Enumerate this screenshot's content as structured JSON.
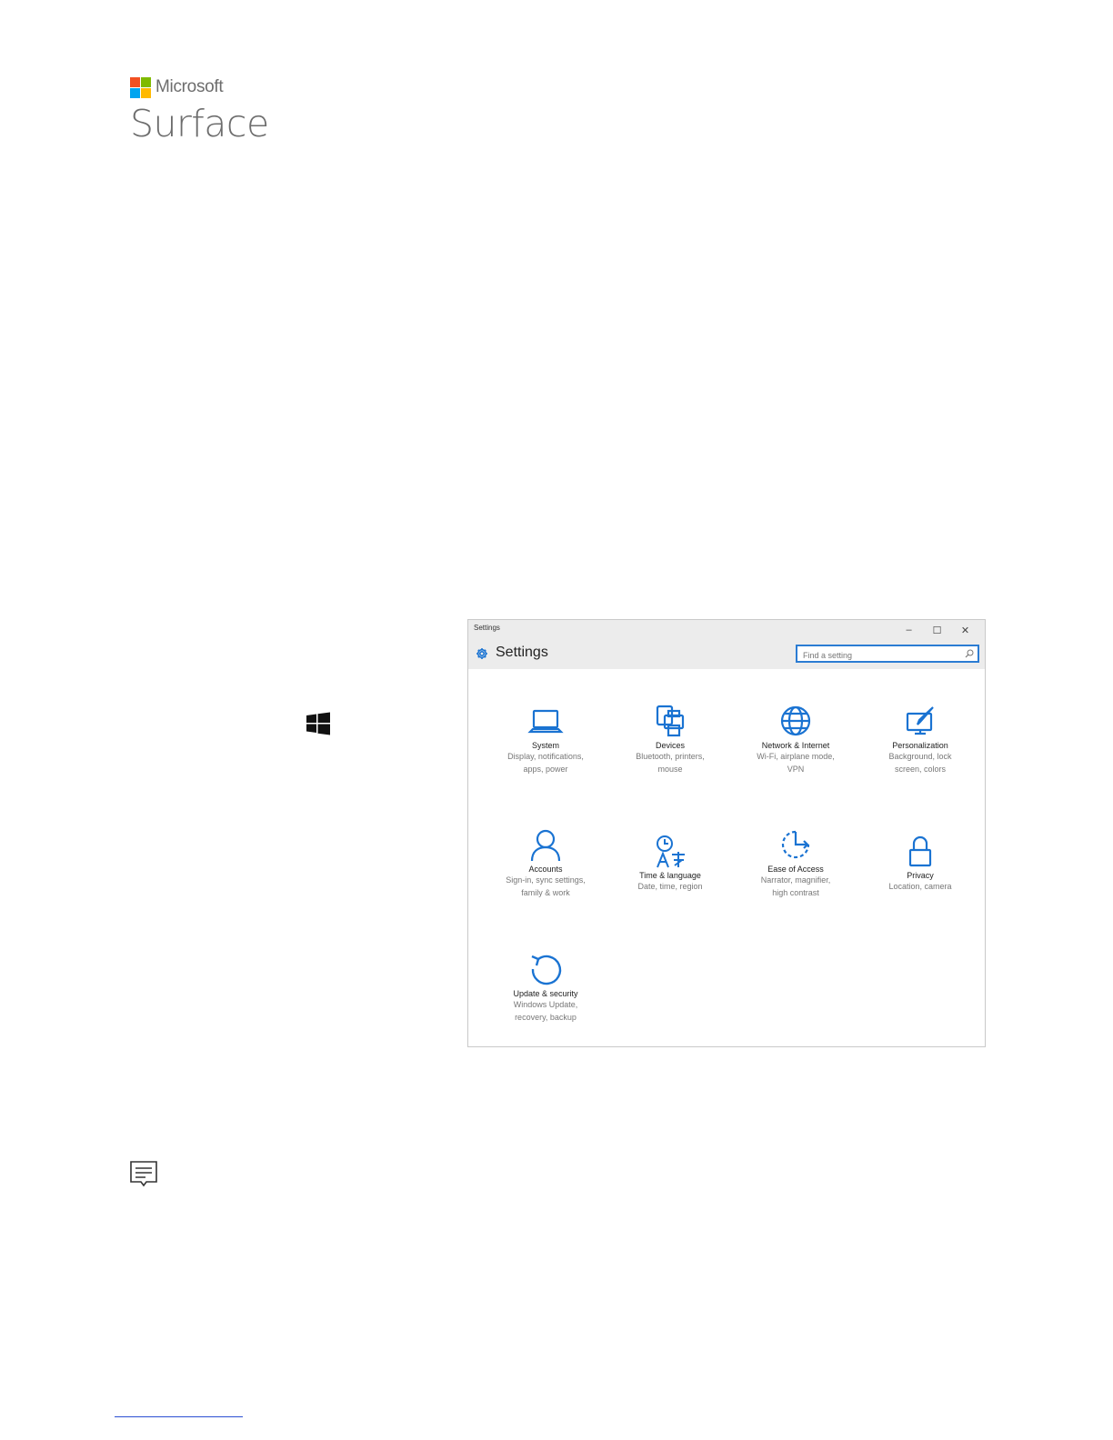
{
  "logo": {
    "brand": "Microsoft",
    "product": "Surface",
    "colors": [
      "#f25022",
      "#7fba00",
      "#00a4ef",
      "#ffb900"
    ]
  },
  "icons": {
    "windows_key": "windows-logo-icon",
    "note": "note-icon"
  },
  "settings_window": {
    "window_title": "Settings",
    "header_title": "Settings",
    "controls": [
      "–",
      "☐",
      "✕"
    ],
    "search_placeholder": "Find a setting",
    "accent": "#1a73d2",
    "tiles": [
      {
        "label": "System",
        "desc1": "Display, notifications,",
        "desc2": "apps, power",
        "icon": "laptop-icon"
      },
      {
        "label": "Devices",
        "desc1": "Bluetooth, printers,",
        "desc2": "mouse",
        "icon": "printer-icon"
      },
      {
        "label": "Network & Internet",
        "desc1": "Wi-Fi, airplane mode,",
        "desc2": "VPN",
        "icon": "globe-icon"
      },
      {
        "label": "Personalization",
        "desc1": "Background, lock",
        "desc2": "screen, colors",
        "icon": "paintbrush-icon"
      },
      {
        "label": "Accounts",
        "desc1": "Sign-in, sync settings,",
        "desc2": "family & work",
        "icon": "person-icon"
      },
      {
        "label": "Time & language",
        "desc1": "Date, time, region",
        "desc2": "",
        "icon": "clock-language-icon"
      },
      {
        "label": "Ease of Access",
        "desc1": "Narrator, magnifier,",
        "desc2": "high contrast",
        "icon": "ease-of-access-icon"
      },
      {
        "label": "Privacy",
        "desc1": "Location, camera",
        "desc2": "",
        "icon": "lock-icon"
      },
      {
        "label": "Update & security",
        "desc1": "Windows Update,",
        "desc2": "recovery, backup",
        "icon": "refresh-icon"
      }
    ]
  }
}
